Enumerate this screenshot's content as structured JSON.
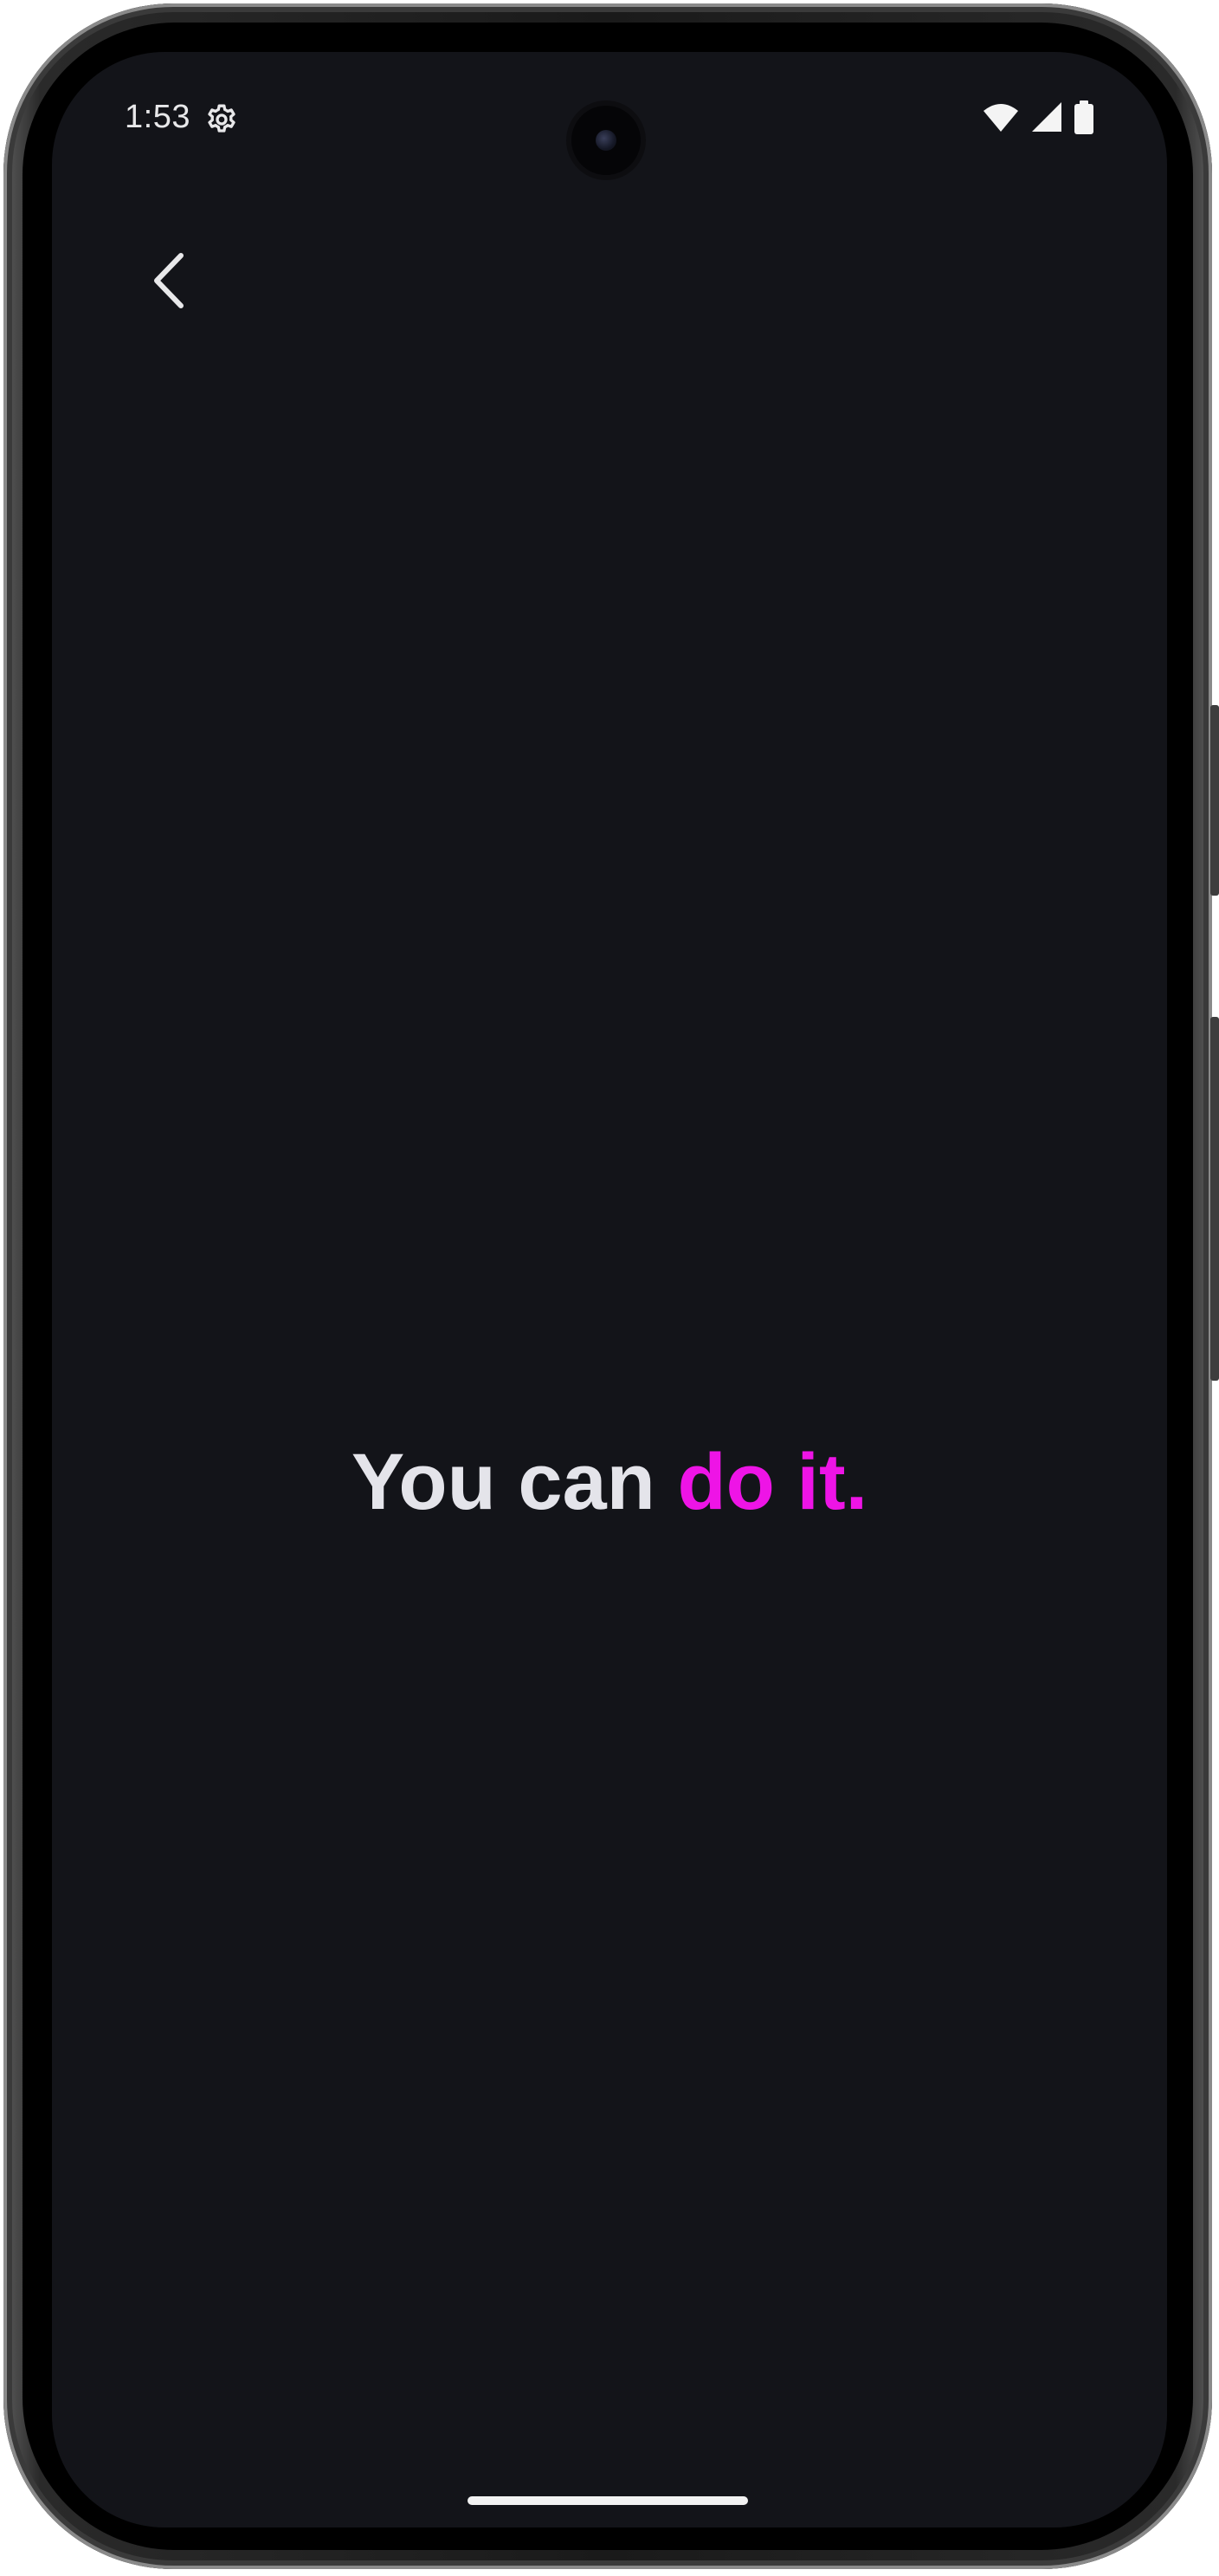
{
  "status_bar": {
    "time": "1:53",
    "icons": [
      "gear-icon",
      "wifi-icon",
      "cellular-signal-icon",
      "battery-icon"
    ]
  },
  "navigation": {
    "back_icon": "chevron-left-icon"
  },
  "headline": {
    "part_1": "You can ",
    "part_2": "do it."
  },
  "colors": {
    "background": "#131419",
    "text_primary": "#e4e4ea",
    "accent": "#ee14e6"
  }
}
